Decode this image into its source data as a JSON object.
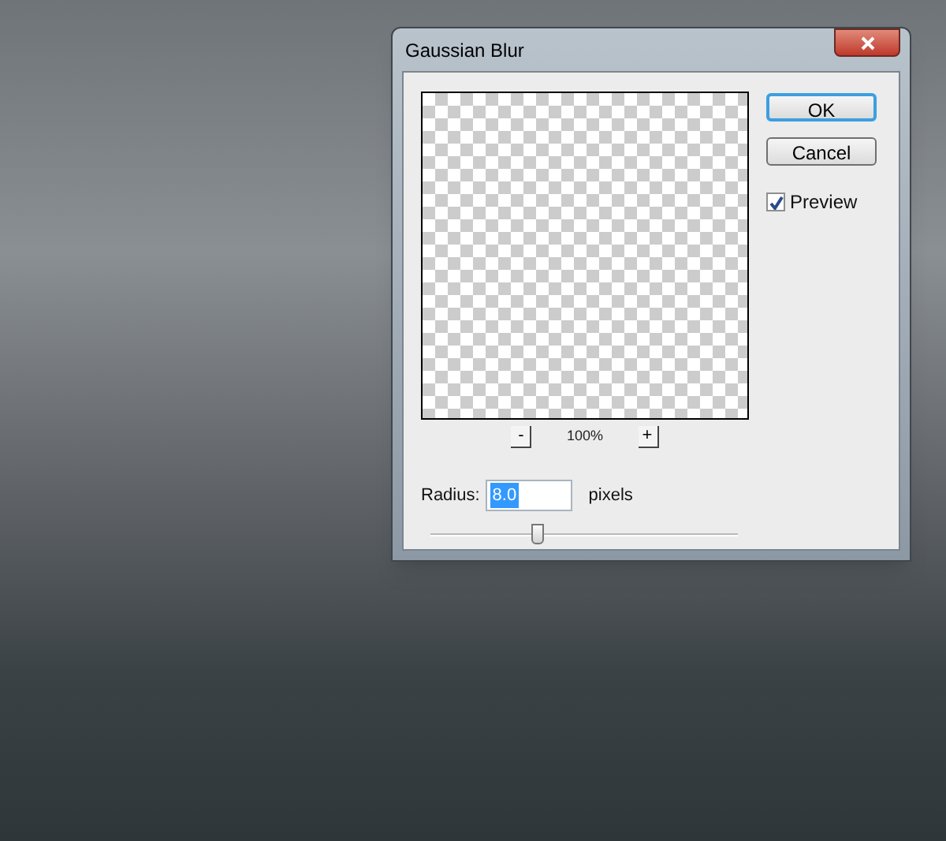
{
  "dialog": {
    "title": "Gaussian Blur",
    "zoom": {
      "minus": "-",
      "percent": "100%",
      "plus": "+"
    },
    "radius": {
      "label": "Radius:",
      "value": "8.0",
      "unit": "pixels",
      "level": 0.35
    },
    "buttons": [
      {
        "label": "OK",
        "default": true
      },
      {
        "label": "Cancel",
        "default": false
      }
    ],
    "preview": {
      "label": "Preview",
      "checked": true
    }
  }
}
